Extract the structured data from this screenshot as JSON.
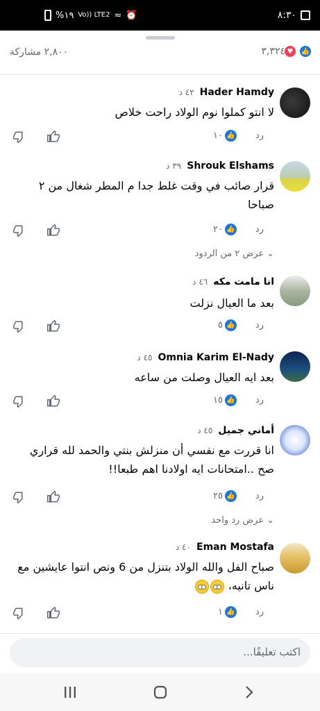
{
  "status_bar": {
    "time": "٨:٣٠",
    "battery": "%١٩",
    "network": "Vo)) LTE2"
  },
  "reactions_bar": {
    "reaction_count": "٣,٣٢٤",
    "share_count": "٢,٨٠٠ مشاركة",
    "like_color": "#1b74e4",
    "love_color": "#f33e58"
  },
  "comments": [
    {
      "author": "Hader Hamdy",
      "time": "٤٢ د",
      "text": "لا انتو كملوا نوم الولاد راحت خلاص",
      "likes": "١٠",
      "reply_label": "رد"
    },
    {
      "author": "Shrouk Elshams",
      "time": "٣٩ د",
      "text": "قرار صائب في وقت غلط جدا م المطر شغال من ٢ صباحا",
      "likes": "٢٠",
      "reply_label": "رد",
      "view_replies": "عرض ٢ من الردود"
    },
    {
      "author": "انا مامت مكه",
      "time": "٤٦ د",
      "text": "بعد ما العيال نزلت",
      "likes": "٥",
      "reply_label": "رد"
    },
    {
      "author": "Omnia Karim El-Nady",
      "time": "٤٥ د",
      "text": "بعد ايه العيال وصلت من ساعه",
      "likes": "١٥",
      "reply_label": "رد"
    },
    {
      "author": "أماني جميل",
      "time": "٤٥ د",
      "text": "انا قررت مع نفسي أن منزلش بنتي والحمد لله قراري صح ..امتحانات ايه اولادنا اهم طبعا!!",
      "likes": "٢٥",
      "reply_label": "رد",
      "view_replies": "عرض رد واحد"
    },
    {
      "author": "Eman Mostafa",
      "time": "٤٠ د",
      "text": "صباح الفل والله الولاد بتنزل من 6 ونص انتوا عايشين مع ناس تانيه،",
      "likes": "١",
      "reply_label": "رد"
    }
  ],
  "composer": {
    "placeholder": "اكتب تعليقًا..."
  },
  "icons": {
    "like": "thumbs-up-icon",
    "dislike": "thumbs-down-icon",
    "emoji": "rolling-eyes-emoji"
  }
}
